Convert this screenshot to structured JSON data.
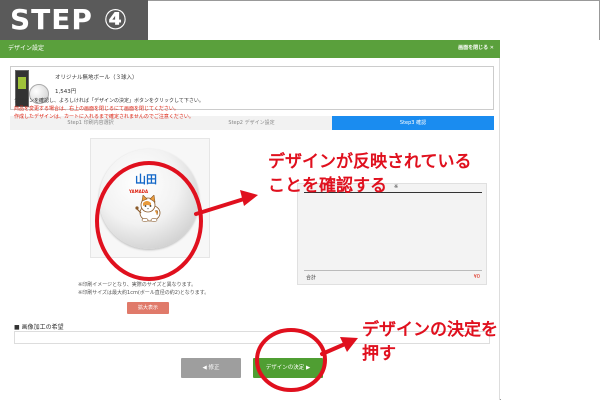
{
  "step_header": "STEP ④",
  "modal": {
    "title": "デザイン設定",
    "close_label": "画面を閉じる ✕"
  },
  "product": {
    "name": "オリジナル無地ボール（３球入）",
    "price": "1,543円"
  },
  "tabs": [
    {
      "label": "Step1 印刷内容選択"
    },
    {
      "label": "Step2 デザイン設定"
    },
    {
      "label": "Step3 確認",
      "active": true
    }
  ],
  "instructions": {
    "line1": "デザインを確認し、よろしければ「デザインの決定」ボタンをクリックして下さい。",
    "line2": "商品を変更する場合は、右上の画面を閉じるにて画面を閉じてください。",
    "line3": "作成したデザインは、カートに入れるまで確定されませんのでご注意ください。"
  },
  "preview": {
    "ball_name": "山田",
    "ball_sub": "YAMADA"
  },
  "notes": {
    "line1": "※印刷イメージとなり、実際のサイズと異なります。",
    "line2": "※印刷サイズは最大約1cm(ボール直径の約2)となります。"
  },
  "enlarge_label": "拡大表示",
  "summary": {
    "star": "※",
    "total_label": "合計",
    "total_value": "¥0"
  },
  "edit_request_label": "■ 画像加工の希望",
  "buttons": {
    "fix_label": "◀ 修正",
    "decide_label": "デザインの決定 ▶"
  },
  "callouts": {
    "reflect_line1": "デザインが反映されている",
    "reflect_line2": "ことを確認する",
    "decide_line1": "デザインの決定を",
    "decide_line2": "押す"
  },
  "colors": {
    "header_green": "#5aa03c",
    "active_tab_blue": "#1a8cf0",
    "callout_red": "#e0101e",
    "decide_green": "#4f9e32"
  }
}
